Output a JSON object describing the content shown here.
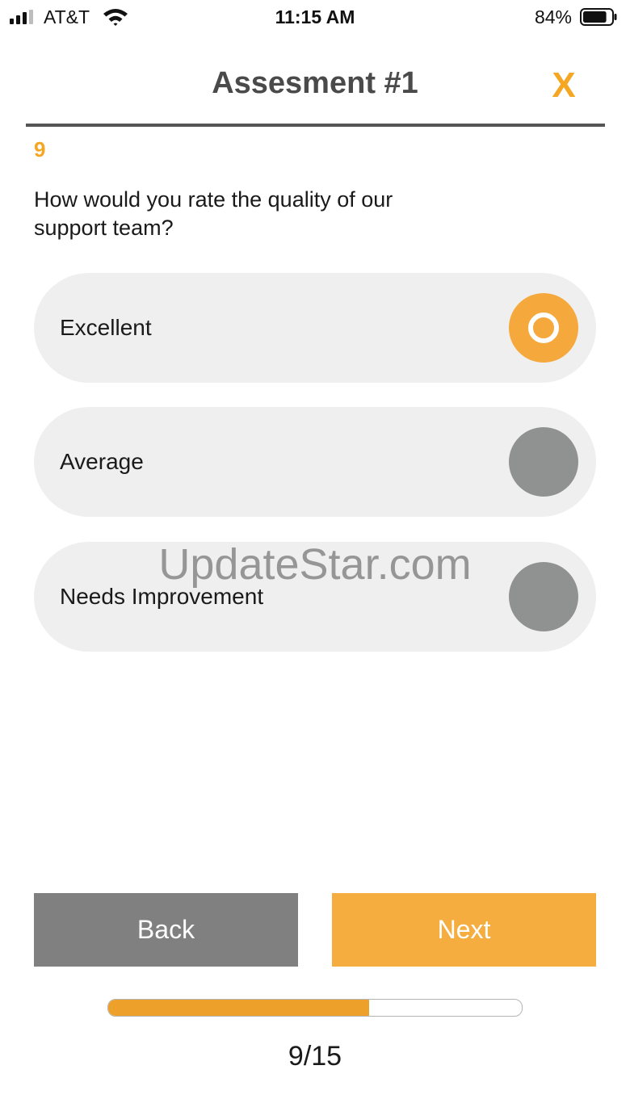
{
  "status_bar": {
    "carrier": "AT&T",
    "time": "11:15 AM",
    "battery_percent": "84%",
    "battery_level": 0.84,
    "signal_bars_active": 3,
    "signal_bars_total": 4,
    "icons": [
      "signal-icon",
      "wifi-icon",
      "battery-icon"
    ]
  },
  "header": {
    "title": "Assesment #1",
    "close_label": "X"
  },
  "question": {
    "number": "9",
    "text": "How would you rate the quality of our support team?"
  },
  "options": [
    {
      "label": "Excellent",
      "selected": true
    },
    {
      "label": "Average",
      "selected": false
    },
    {
      "label": "Needs Improvement",
      "selected": false
    }
  ],
  "watermark": "UpdateStar.com",
  "buttons": {
    "back_label": "Back",
    "next_label": "Next"
  },
  "progress": {
    "current": 9,
    "total": 15,
    "label": "9/15",
    "fraction": 0.63
  },
  "colors": {
    "accent": "#f5a623",
    "selected_radio": "#f5a83c",
    "unselected_radio": "#909191",
    "back_button": "#808080",
    "next_button": "#f5ad40",
    "progress_fill": "#eea12a",
    "option_background": "#efefef",
    "title_text": "#4a4a4a"
  }
}
